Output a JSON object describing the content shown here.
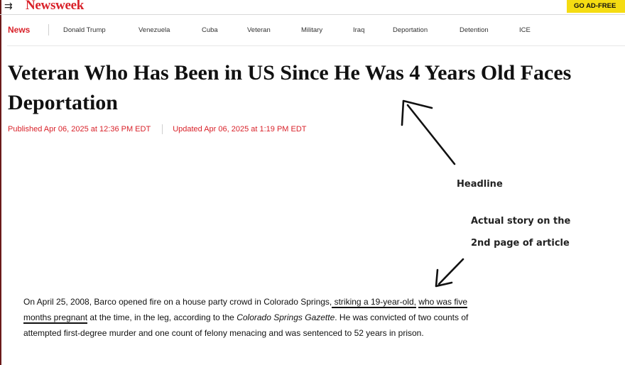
{
  "header": {
    "logo": "Newsweek",
    "cta": "GO AD-FREE",
    "menu_icon": "hamburger-menu-icon"
  },
  "nav": {
    "section": "News",
    "items": [
      "Donald Trump",
      "Venezuela",
      "Cuba",
      "Veteran",
      "Military",
      "Iraq",
      "Deportation",
      "Detention",
      "ICE"
    ]
  },
  "article": {
    "headline": "Veteran Who Has Been in US Since He Was 4 Years Old Faces Deportation",
    "published": "Published Apr 06, 2025 at 12:36 PM EDT",
    "updated": "Updated Apr 06, 2025 at 1:19 PM EDT"
  },
  "annotations": {
    "headline_label": "Headline",
    "story_label_line1": "Actual story on the",
    "story_label_line2": "2nd page of article"
  },
  "story": {
    "p1": "On April 25, 2008, Barco opened fire on a house party crowd in Colorado Springs,",
    "u1": " striking a 19-year-old,",
    "p2": " ",
    "u2": "who was five months pregnant",
    "p3": " at the time, in the leg, according to the ",
    "source": "Colorado Springs Gazette",
    "p4": ". He was convicted of two counts of attempted first-degree murder and one count of felony menacing and was sentenced to 52 years in prison."
  },
  "colors": {
    "brand_red": "#d9222a",
    "cta_yellow": "#f5dc12"
  }
}
